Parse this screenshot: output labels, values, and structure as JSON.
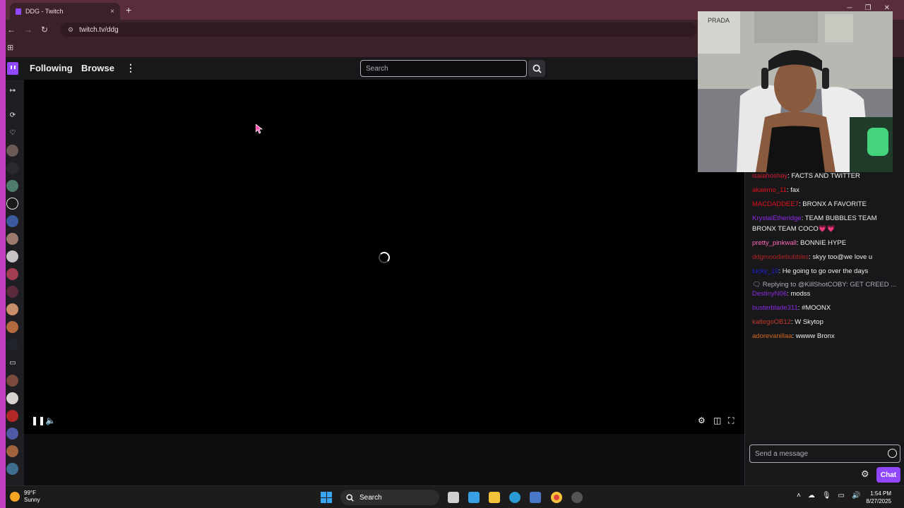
{
  "browser": {
    "tab_title": "DDG - Twitch",
    "tab_close": "×",
    "new_tab": "+",
    "url": "twitch.tv/ddg"
  },
  "twitch": {
    "nav": {
      "following": "Following",
      "browse": "Browse",
      "more": "⋮"
    },
    "search": {
      "placeholder": "Search"
    },
    "chat": {
      "messages": [
        {
          "user": "isaiahoshay",
          "color": "#d0192a",
          "text": ": FACTS AND TWITTER"
        },
        {
          "user": "akaemo_11",
          "color": "#e0101d",
          "text": ": fax"
        },
        {
          "user": "MACDADDEE7",
          "color": "#e0101d",
          "text": ": BRONX A FAVORITE"
        },
        {
          "user": "KrystalEtheridge",
          "color": "#8a2be2",
          "text": ": TEAM BUBBLES TEAM BRONX TEAM COCO💗💗"
        },
        {
          "user": "pretty_pinkwall",
          "color": "#ff69b4",
          "text": ": BONNIE HYPE"
        },
        {
          "user": "ddgmoodiebubbles",
          "color": "#b22222",
          "text": ": skyy too@we love u"
        },
        {
          "user": "lucky_10",
          "color": "#1e1ed9",
          "text": ": He going to go over the days"
        },
        {
          "user": "DestinyN06",
          "color": "#8a2be2",
          "text": ": modss"
        },
        {
          "user": "busterblade311",
          "color": "#8a2be2",
          "text": ": #MOONX"
        },
        {
          "user": "katlegoOB12",
          "color": "#c0392b",
          "text": ": W Skytop"
        },
        {
          "user": "adorevanillaa",
          "color": "#d2691e",
          "text": ": wwww Bronx"
        }
      ],
      "reply_preview": "Replying to @KillShotCOBY: GET CREED ...",
      "input_placeholder": "Send a message",
      "chat_button": "Chat"
    }
  },
  "taskbar": {
    "weather_temp": "99°F",
    "weather_desc": "Sunny",
    "search_label": "Search",
    "time": "1:54 PM",
    "date": "8/27/2025"
  }
}
